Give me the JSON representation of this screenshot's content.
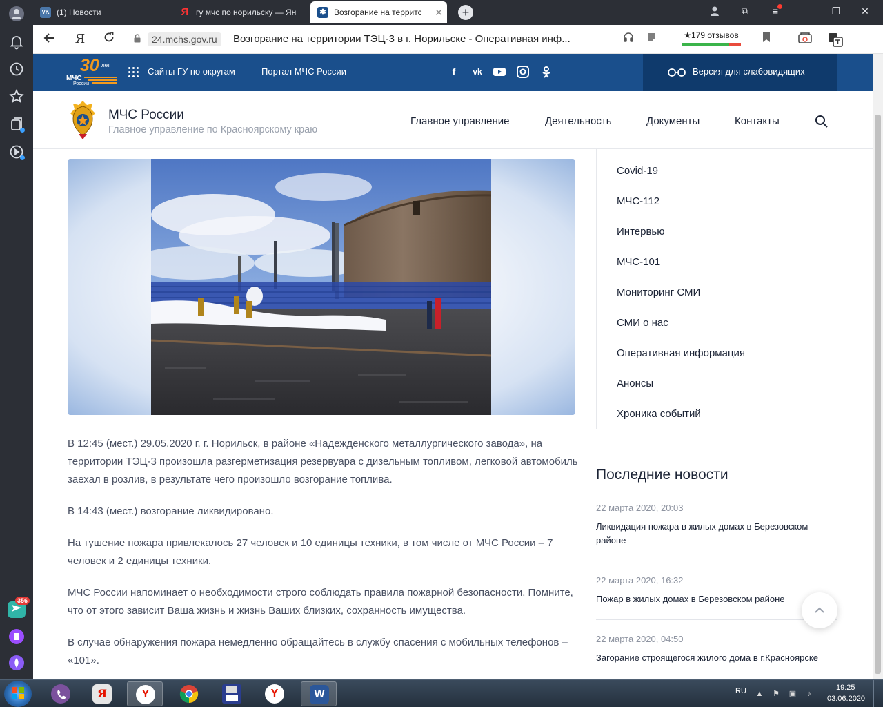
{
  "browser": {
    "tabs": [
      {
        "label": "(1) Новости",
        "icon": "VK"
      },
      {
        "label": "гу мчс по норильску — Ян",
        "icon": "Я"
      },
      {
        "label": "Возгорание на территс",
        "icon": "✱"
      }
    ],
    "address": {
      "domain": "24.mchs.gov.ru",
      "title": "Возгорание на территории ТЭЦ-3 в г. Норильске - Оперативная инф..."
    },
    "reviews": "★179 отзывов",
    "rail_badge": "356",
    "icons": [
      "profile-icon",
      "bell-icon",
      "history-icon",
      "star-icon",
      "collections-icon",
      "video-icon",
      "messenger-icon",
      "notes-icon",
      "alice-icon"
    ]
  },
  "site_top": {
    "logo_number": "30",
    "logo_years": "лет",
    "logo_brand": "МЧС",
    "logo_sub": "России",
    "links": [
      "Сайты ГУ по округам",
      "Портал МЧС России"
    ],
    "socials": [
      "f",
      "vk",
      "▶",
      "◎",
      "ok"
    ],
    "vision": "Версия для слабовидящих"
  },
  "header": {
    "org_name": "МЧС России",
    "org_sub": "Главное управление по Красноярскому краю",
    "nav": [
      "Главное управление",
      "Деятельность",
      "Документы",
      "Контакты"
    ]
  },
  "article": {
    "paragraphs": [
      "В 12:45 (мест.) 29.05.2020 г. г. Норильск, в районе «Надежденского металлургического завода», на территории ТЭЦ-3 произошла разгерметизация резервуара с дизельным топливом, легковой автомобиль заехал в розлив, в результате чего произошло возгорание топлива.",
      "В 14:43 (мест.) возгорание ликвидировано.",
      "На тушение пожара привлекалось 27 человек и 10 единицы техники, в том числе от МЧС России – 7 человек и 2 единицы техники.",
      "МЧС России напоминает о необходимости строго соблюдать правила пожарной безопасности. Помните, что от этого зависит Ваша жизнь и жизнь Ваших близких, сохранность имущества.",
      "В случае обнаружения пожара немедленно обращайтесь в службу спасения с мобильных телефонов – «101»."
    ]
  },
  "sidebar": {
    "menu": [
      "Covid-19",
      "МЧС-112",
      "Интервью",
      "МЧС-101",
      "Мониторинг СМИ",
      "СМИ о нас",
      "Оперативная информация",
      "Анонсы",
      "Хроника событий"
    ],
    "news_heading": "Последние новости",
    "news": [
      {
        "date": "22 марта 2020, 20:03",
        "title": "Ликвидация пожара в жилых домах в Березовском районе"
      },
      {
        "date": "22 марта 2020, 16:32",
        "title": "Пожар в жилых домах в Березовском районе"
      },
      {
        "date": "22 марта 2020, 04:50",
        "title": "Загорание строящегося жилого дома в г.Красноярске"
      }
    ]
  },
  "taskbar": {
    "lang": "RU",
    "time": "19:25",
    "date": "03.06.2020"
  },
  "colors": {
    "site_blue": "#1a4f8c",
    "site_blue_dark": "#0f3a6c",
    "text": "#1c2436",
    "muted": "#9aa1ad",
    "accent_orange": "#f39a1e"
  }
}
